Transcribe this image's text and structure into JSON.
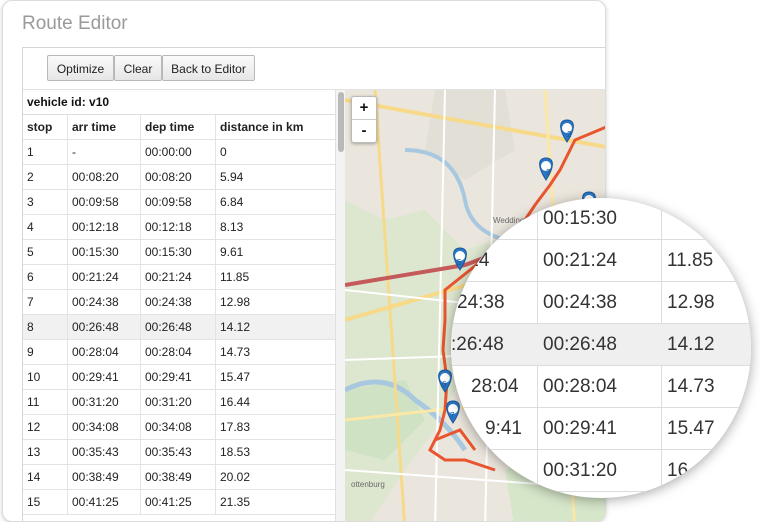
{
  "app": {
    "title": "Route Editor"
  },
  "toolbar": {
    "optimize_label": "Optimize",
    "clear_label": "Clear",
    "back_label": "Back to Editor"
  },
  "table": {
    "vehicle_label": "vehicle id: v10",
    "headers": {
      "stop": "stop",
      "arr": "arr time",
      "dep": "dep time",
      "dist": "distance in km"
    },
    "rows": [
      {
        "stop": "1",
        "arr": "-",
        "dep": "00:00:00",
        "dist": "0"
      },
      {
        "stop": "2",
        "arr": "00:08:20",
        "dep": "00:08:20",
        "dist": "5.94"
      },
      {
        "stop": "3",
        "arr": "00:09:58",
        "dep": "00:09:58",
        "dist": "6.84"
      },
      {
        "stop": "4",
        "arr": "00:12:18",
        "dep": "00:12:18",
        "dist": "8.13"
      },
      {
        "stop": "5",
        "arr": "00:15:30",
        "dep": "00:15:30",
        "dist": "9.61"
      },
      {
        "stop": "6",
        "arr": "00:21:24",
        "dep": "00:21:24",
        "dist": "11.85"
      },
      {
        "stop": "7",
        "arr": "00:24:38",
        "dep": "00:24:38",
        "dist": "12.98"
      },
      {
        "stop": "8",
        "arr": "00:26:48",
        "dep": "00:26:48",
        "dist": "14.12"
      },
      {
        "stop": "9",
        "arr": "00:28:04",
        "dep": "00:28:04",
        "dist": "14.73"
      },
      {
        "stop": "10",
        "arr": "00:29:41",
        "dep": "00:29:41",
        "dist": "15.47"
      },
      {
        "stop": "11",
        "arr": "00:31:20",
        "dep": "00:31:20",
        "dist": "16.44"
      },
      {
        "stop": "12",
        "arr": "00:34:08",
        "dep": "00:34:08",
        "dist": "17.83"
      },
      {
        "stop": "13",
        "arr": "00:35:43",
        "dep": "00:35:43",
        "dist": "18.53"
      },
      {
        "stop": "14",
        "arr": "00:38:49",
        "dep": "00:38:49",
        "dist": "20.02"
      },
      {
        "stop": "15",
        "arr": "00:41:25",
        "dep": "00:41:25",
        "dist": "21.35"
      }
    ]
  },
  "map": {
    "zoom_in": "+",
    "zoom_out": "-",
    "labels": {
      "wedding": "Wedding",
      "charlottenburg": "ottenburg"
    },
    "markers": [
      "2",
      "3",
      "14",
      "5",
      "6",
      "7"
    ],
    "colors": {
      "route": "#e8552f",
      "marker": "#2a76c4"
    }
  },
  "magnifier": {
    "rows": [
      {
        "arr": "",
        "dep": "00:15:30",
        "dist": ""
      },
      {
        "arr": ":24",
        "dep": "00:21:24",
        "dist": "11.85"
      },
      {
        "arr": "24:38",
        "dep": "00:24:38",
        "dist": "12.98"
      },
      {
        "arr": ":26:48",
        "dep": "00:26:48",
        "dist": "14.12"
      },
      {
        "arr": "28:04",
        "dep": "00:28:04",
        "dist": "14.73"
      },
      {
        "arr": "9:41",
        "dep": "00:29:41",
        "dist": "15.47"
      },
      {
        "arr": "",
        "dep": "00:31:20",
        "dist": "16"
      }
    ]
  }
}
